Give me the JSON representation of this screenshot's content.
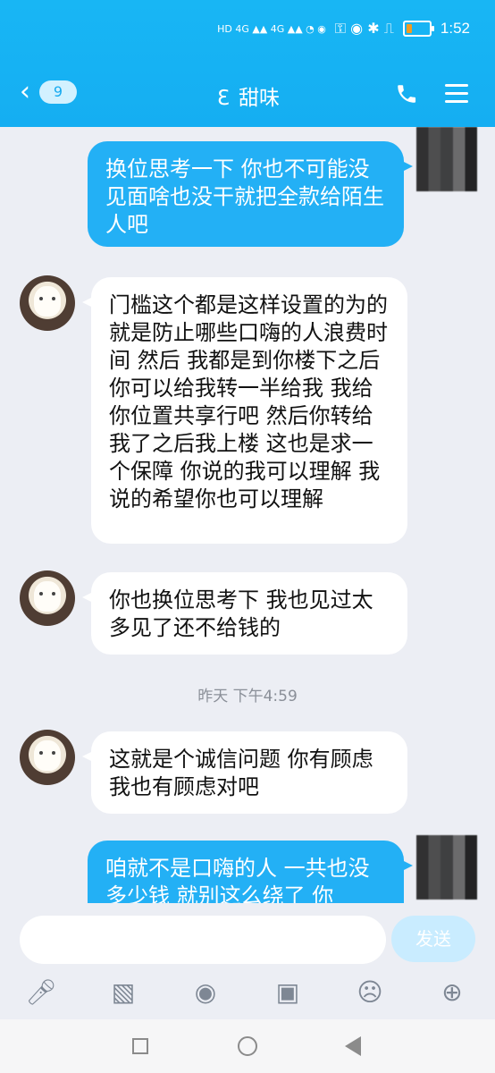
{
  "header": {
    "back_count": "9",
    "title": "甜味"
  },
  "status": {
    "time": "1:52",
    "battery_percent": 20
  },
  "messages": [
    {
      "side": "right",
      "text": "换位思考一下 你也不可能没见面啥也没干就把全款给陌生人吧"
    },
    {
      "side": "left",
      "text": "门槛这个都是这样设置的为的就是防止哪些口嗨的人浪费时间 然后 我都是到你楼下之后你可以给我转一半给我 我给你位置共享行吧 然后你转给我了之后我上楼 这也是求一个保障 你说的我可以理解 我说的希望你也可以理解"
    },
    {
      "side": "left",
      "text": "你也换位思考下 我也见过太多见了还不给钱的"
    },
    {
      "side": "left",
      "text": "这就是个诚信问题 你有顾虑我也有顾虑对吧"
    },
    {
      "side": "right",
      "text": "咱就不是口嗨的人 一共也没多少钱 就别这么绕了 你"
    }
  ],
  "timestamp": "昨天 下午4:59",
  "composer": {
    "send_label": "发送"
  },
  "icons": {
    "mic": "mic-icon",
    "image": "image-icon",
    "camera": "camera-icon",
    "wallet": "wallet-icon",
    "emoji": "emoji-icon",
    "plus": "plus-icon"
  }
}
